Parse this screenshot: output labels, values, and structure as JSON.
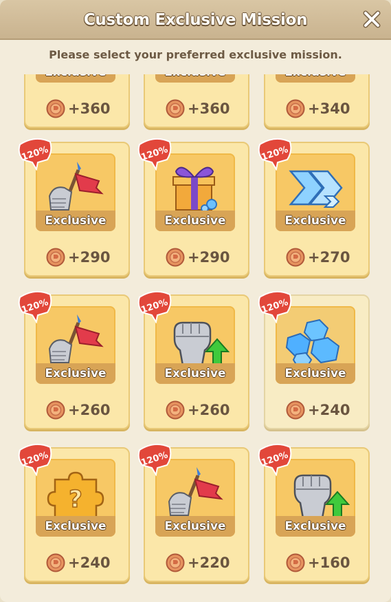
{
  "dialog": {
    "title": "Custom Exclusive Mission",
    "subtitle": "Please select your preferred exclusive mission.",
    "close_icon": "close-icon"
  },
  "colors": {
    "card_bg": "#fbe7a9",
    "icon_bg": "#f7c865",
    "badge_red": "#e2473a",
    "title_bar": "#d3bf9c"
  },
  "missions": [
    {
      "reward": "+360",
      "icon": "partial-icon"
    },
    {
      "reward": "+360",
      "icon": "partial-icon"
    },
    {
      "reward": "+340",
      "icon": "partial-icon"
    },
    {
      "badge": "120%",
      "label": "Exclusive",
      "reward": "+290",
      "icon": "flag-gauntlet-icon"
    },
    {
      "badge": "120%",
      "label": "Exclusive",
      "reward": "+290",
      "icon": "gift-box-icon"
    },
    {
      "badge": "120%",
      "label": "Exclusive",
      "reward": "+270",
      "icon": "speed-arrows-icon"
    },
    {
      "badge": "120%",
      "label": "Exclusive",
      "reward": "+260",
      "icon": "flag-gauntlet-icon"
    },
    {
      "badge": "120%",
      "label": "Exclusive",
      "reward": "+260",
      "icon": "fist-upgrade-icon"
    },
    {
      "badge": "120%",
      "label": "Exclusive",
      "reward": "+240",
      "icon": "blue-gems-icon",
      "selected": true
    },
    {
      "badge": "120%",
      "label": "Exclusive",
      "reward": "+240",
      "icon": "mystery-puzzle-icon"
    },
    {
      "badge": "120%",
      "label": "Exclusive",
      "reward": "+220",
      "icon": "flag-gauntlet-icon"
    },
    {
      "badge": "120%",
      "label": "Exclusive",
      "reward": "+160",
      "icon": "fist-upgrade-icon"
    }
  ]
}
